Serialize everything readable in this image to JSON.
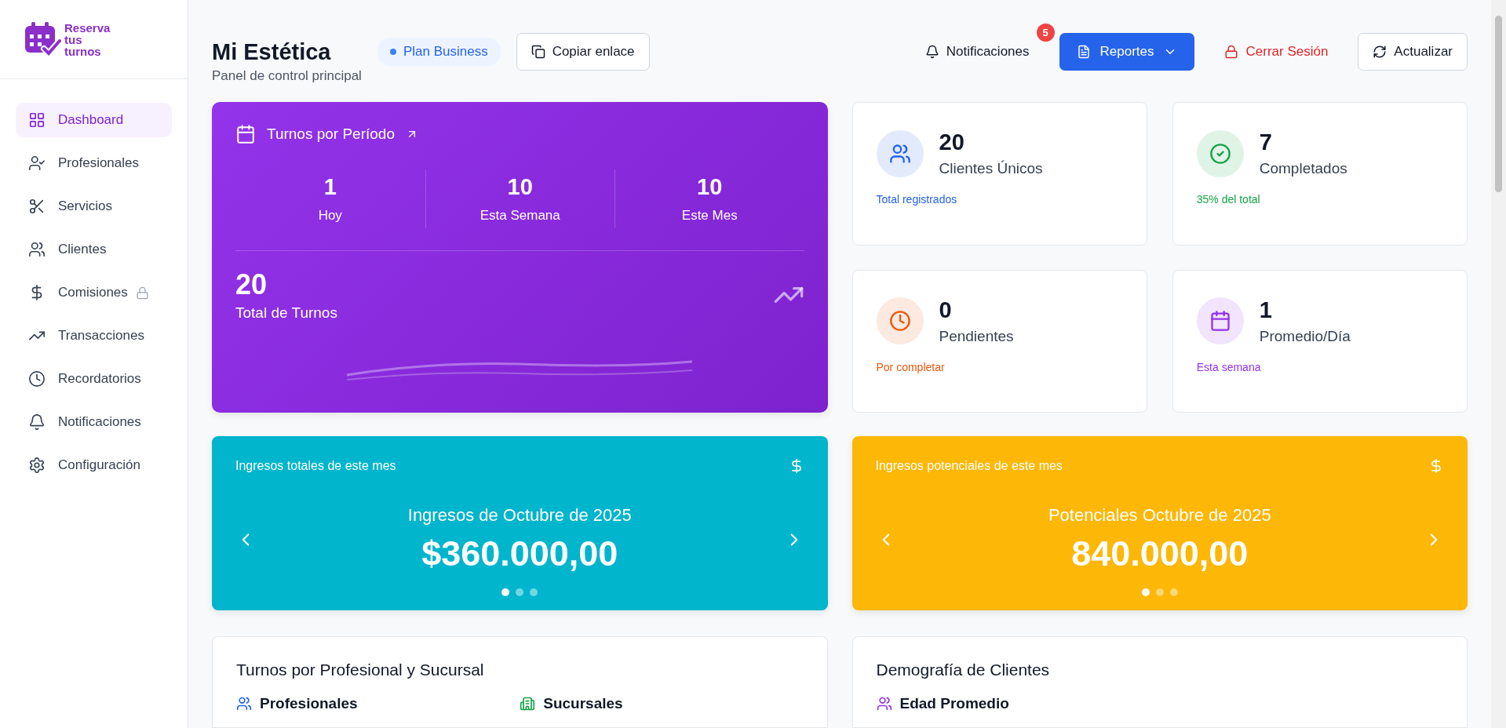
{
  "brand": {
    "lines": [
      "Reserva",
      "tus",
      "turnos"
    ]
  },
  "sidebar": {
    "items": [
      {
        "label": "Dashboard",
        "selected": true,
        "locked": false
      },
      {
        "label": "Profesionales",
        "selected": false,
        "locked": false
      },
      {
        "label": "Servicios",
        "selected": false,
        "locked": false
      },
      {
        "label": "Clientes",
        "selected": false,
        "locked": false
      },
      {
        "label": "Comisiones",
        "selected": false,
        "locked": true
      },
      {
        "label": "Transacciones",
        "selected": false,
        "locked": false
      },
      {
        "label": "Recordatorios",
        "selected": false,
        "locked": false
      },
      {
        "label": "Notificaciones",
        "selected": false,
        "locked": false
      },
      {
        "label": "Configuración",
        "selected": false,
        "locked": false
      }
    ]
  },
  "header": {
    "title": "Mi Estética",
    "subtitle": "Panel de control principal",
    "plan_badge": "Plan Business",
    "copy_button": "Copiar enlace",
    "notifications": {
      "label": "Notificaciones",
      "badge": "5"
    },
    "reports_button": "Reportes",
    "logout_button": "Cerrar Sesión",
    "refresh_button": "Actualizar"
  },
  "period_card": {
    "title": "Turnos por Período",
    "stats": [
      {
        "value": "1",
        "label": "Hoy"
      },
      {
        "value": "10",
        "label": "Esta Semana"
      },
      {
        "value": "10",
        "label": "Este Mes"
      }
    ],
    "total": {
      "value": "20",
      "label": "Total de Turnos"
    }
  },
  "stat_cards": [
    {
      "value": "20",
      "label": "Clientes Únicos",
      "note": "Total registrados",
      "color": "#2563eb"
    },
    {
      "value": "7",
      "label": "Completados",
      "note": "35% del total",
      "color": "#16a34a"
    },
    {
      "value": "0",
      "label": "Pendientes",
      "note": "Por completar",
      "color": "#ea580c"
    },
    {
      "value": "1",
      "label": "Promedio/Día",
      "note": "Esta semana",
      "color": "#9333ea"
    }
  ],
  "revenue_cards": [
    {
      "caption": "Ingresos totales de este mes",
      "heading": "Ingresos de Octubre de 2025",
      "amount": "$360.000,00",
      "color": "#00b5cc",
      "dots": [
        {
          "selected": true
        },
        {
          "selected": false
        },
        {
          "selected": false
        }
      ]
    },
    {
      "caption": "Ingresos potenciales de este mes",
      "heading": "Potenciales Octubre de 2025",
      "amount": "840.000,00",
      "color": "#fdb706",
      "dots": [
        {
          "selected": true
        },
        {
          "selected": false
        },
        {
          "selected": false
        }
      ]
    }
  ],
  "panels": [
    {
      "title": "Turnos por Profesional y Sucursal",
      "sections": [
        "Profesionales",
        "Sucursales"
      ]
    },
    {
      "title": "Demografía de Clientes",
      "sections": [
        "Edad Promedio"
      ]
    }
  ]
}
